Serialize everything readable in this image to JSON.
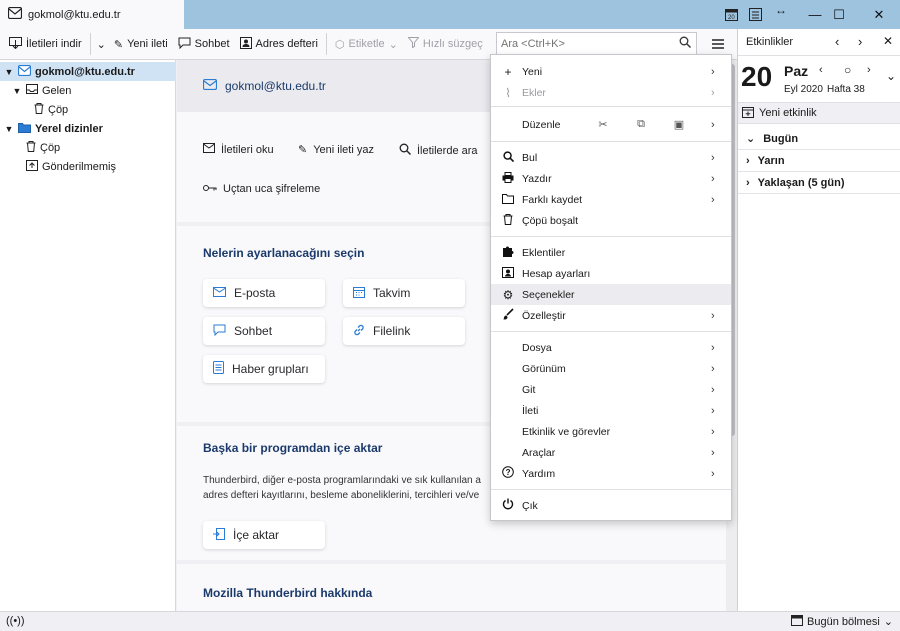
{
  "window": {
    "tab_title": "gokmol@ktu.edu.tr",
    "minimize_symbol": "—",
    "maximize_symbol": "☐",
    "close_symbol": "✕"
  },
  "toolbar": {
    "get_messages": "İletileri indir",
    "new_message": "Yeni ileti",
    "chat": "Sohbet",
    "address_book": "Adres defteri",
    "tag": "Etiketle",
    "quick_filter": "Hızlı süzgeç",
    "search_placeholder": "Ara <Ctrl+K>"
  },
  "folders": {
    "account": "gokmol@ktu.edu.tr",
    "inbox": "Gelen",
    "inbox_trash": "Çöp",
    "local_folders": "Yerel dizinler",
    "local_trash": "Çöp",
    "unsent": "Gönderilmemiş"
  },
  "main": {
    "account_title": "gokmol@ktu.edu.tr",
    "actions": {
      "read": "İletileri oku",
      "write": "Yeni ileti yaz",
      "search": "İletilerde ara",
      "e2e": "Uçtan uca şifreleme"
    },
    "setup_title": "Nelerin ayarlanacağını seçin",
    "setup_cards": {
      "email": "E-posta",
      "calendar": "Takvim",
      "chat": "Sohbet",
      "filelink": "Filelink",
      "newsgroups": "Haber grupları"
    },
    "import_title": "Başka bir programdan içe aktar",
    "import_text_1": "Thunderbird, diğer e-posta programlarındaki ve sık kullanılan a",
    "import_text_2": "adres defteri kayıtlarını, besleme aboneliklerini, tercihleri ve/ve",
    "import_button": "İçe aktar",
    "about_title": "Mozilla Thunderbird hakkında"
  },
  "menu": {
    "new": "Yeni",
    "attachments": "Ekler",
    "edit": "Düzenle",
    "find": "Bul",
    "print": "Yazdır",
    "save_as": "Farklı kaydet",
    "empty_trash": "Çöpü boşalt",
    "addons": "Eklentiler",
    "account_settings": "Hesap ayarları",
    "options": "Seçenekler",
    "customize": "Özelleştir",
    "file": "Dosya",
    "view": "Görünüm",
    "go": "Git",
    "message": "İleti",
    "events_tasks": "Etkinlik ve görevler",
    "tools": "Araçlar",
    "help": "Yardım",
    "quit": "Çık"
  },
  "calendar": {
    "header": "Etkinlikler",
    "day": "20",
    "weekday": "Paz",
    "month_year": "Eyl 2020",
    "week": "Hafta 38",
    "new_event": "Yeni etkinlik",
    "today": "Bugün",
    "tomorrow": "Yarın",
    "upcoming": "Yaklaşan (5 gün)"
  },
  "statusbar": {
    "today_pane": "Bugün bölmesi"
  }
}
